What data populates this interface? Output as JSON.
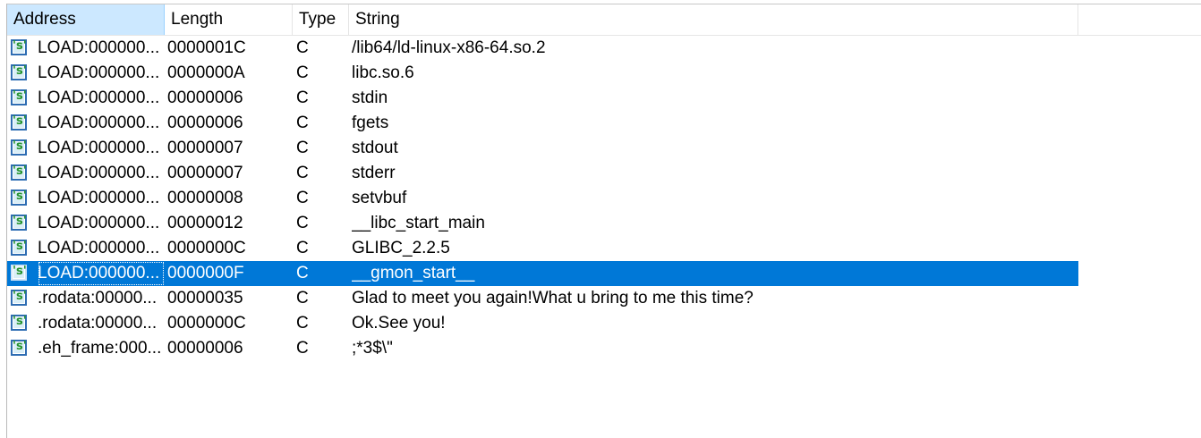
{
  "columns": {
    "address": "Address",
    "length": "Length",
    "type": "Type",
    "string": "String"
  },
  "icon": {
    "name": "string-icon",
    "glyph": "'s'"
  },
  "selected_index": 9,
  "rows": [
    {
      "address": "LOAD:000000...",
      "length": "0000001C",
      "type": "C",
      "string": "/lib64/ld-linux-x86-64.so.2"
    },
    {
      "address": "LOAD:000000...",
      "length": "0000000A",
      "type": "C",
      "string": "libc.so.6"
    },
    {
      "address": "LOAD:000000...",
      "length": "00000006",
      "type": "C",
      "string": "stdin"
    },
    {
      "address": "LOAD:000000...",
      "length": "00000006",
      "type": "C",
      "string": "fgets"
    },
    {
      "address": "LOAD:000000...",
      "length": "00000007",
      "type": "C",
      "string": "stdout"
    },
    {
      "address": "LOAD:000000...",
      "length": "00000007",
      "type": "C",
      "string": "stderr"
    },
    {
      "address": "LOAD:000000...",
      "length": "00000008",
      "type": "C",
      "string": "setvbuf"
    },
    {
      "address": "LOAD:000000...",
      "length": "00000012",
      "type": "C",
      "string": "__libc_start_main"
    },
    {
      "address": "LOAD:000000...",
      "length": "0000000C",
      "type": "C",
      "string": "GLIBC_2.2.5"
    },
    {
      "address": "LOAD:000000...",
      "length": "0000000F",
      "type": "C",
      "string": "__gmon_start__"
    },
    {
      "address": ".rodata:00000...",
      "length": "00000035",
      "type": "C",
      "string": "Glad to meet you again!What u bring to me this time?"
    },
    {
      "address": ".rodata:00000...",
      "length": "0000000C",
      "type": "C",
      "string": "Ok.See you!"
    },
    {
      "address": ".eh_frame:000...",
      "length": "00000006",
      "type": "C",
      "string": ";*3$\\\""
    }
  ],
  "colors": {
    "selection": "#0078d7",
    "sorted_header": "#cce8ff",
    "icon_border": "#2e6db3",
    "icon_glyph": "#24932c"
  }
}
